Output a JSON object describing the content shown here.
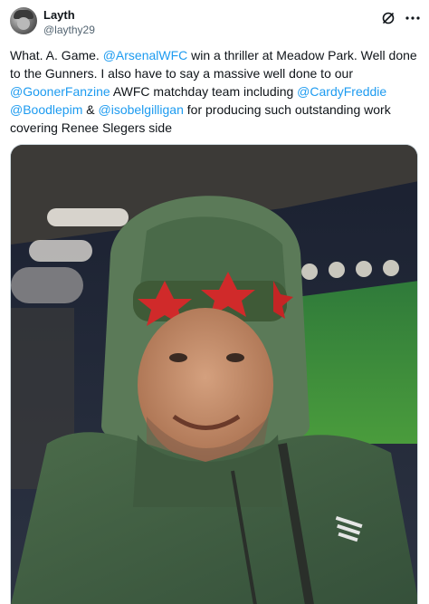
{
  "author": {
    "name": "Layth",
    "handle": "@laythy29"
  },
  "icons": {
    "grok": "grok-icon",
    "more": "more-horizontal-icon"
  },
  "tweet": {
    "parts": [
      {
        "t": "text",
        "v": "What. A. Game. "
      },
      {
        "t": "mention",
        "v": "@ArsenalWFC"
      },
      {
        "t": "text",
        "v": " win a thriller at Meadow Park. Well done to the Gunners. I also have to say a massive well done to our "
      },
      {
        "t": "mention",
        "v": "@GoonerFanzine"
      },
      {
        "t": "text",
        "v": " AWFC matchday team including "
      },
      {
        "t": "mention",
        "v": "@CardyFreddie"
      },
      {
        "t": "text",
        "v": " "
      },
      {
        "t": "mention",
        "v": "@Boodlepim"
      },
      {
        "t": "text",
        "v": " & "
      },
      {
        "t": "mention",
        "v": "@isobelgilligan"
      },
      {
        "t": "text",
        "v": " for producing such outstanding work covering Renee Slegers side"
      }
    ]
  },
  "colors": {
    "mention": "#1d9bf0",
    "text": "#0f1419",
    "secondary": "#536471"
  }
}
